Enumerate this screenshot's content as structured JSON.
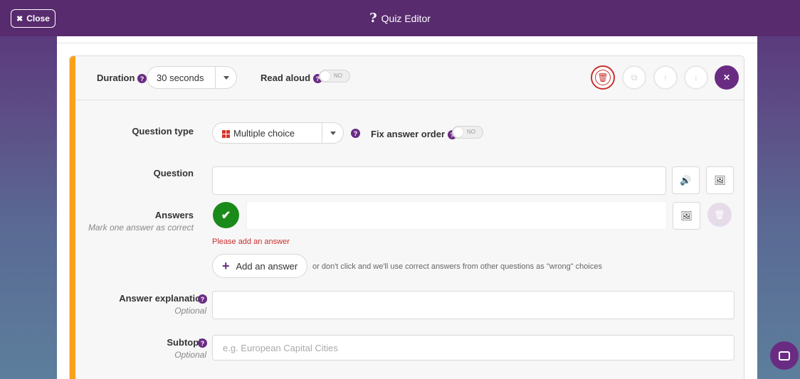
{
  "header": {
    "close_label": "Close",
    "title": "Quiz Editor",
    "title_icon": "question-mark-icon"
  },
  "settings": {
    "duration_label": "Duration",
    "duration_value": "30 seconds",
    "read_aloud_label": "Read aloud",
    "read_aloud_state": "NO",
    "action_buttons": [
      "delete",
      "duplicate",
      "move-up",
      "move-down",
      "close"
    ]
  },
  "form": {
    "question_type_label": "Question type",
    "question_type_value": "Multiple choice",
    "fix_order_label": "Fix answer order",
    "fix_order_state": "NO",
    "question_label": "Question",
    "question_value": "",
    "answers_label": "Answers",
    "answers_hint": "Mark one answer as correct",
    "answer_value": "",
    "answer_error": "Please add an answer",
    "add_answer_label": "Add an answer",
    "add_answer_note": "or don't click and we'll use correct answers from other questions as \"wrong\" choices",
    "explanation_label": "Answer explanation",
    "explanation_hint": "Optional",
    "explanation_value": "",
    "subtopic_label": "Subtopic",
    "subtopic_hint": "Optional",
    "subtopic_placeholder": "e.g. European Capital Cities"
  },
  "colors": {
    "brand_purple": "#582b6e",
    "accent_orange": "#f9a11b",
    "correct_green": "#1a8a1a",
    "error_red": "#c9302c"
  }
}
